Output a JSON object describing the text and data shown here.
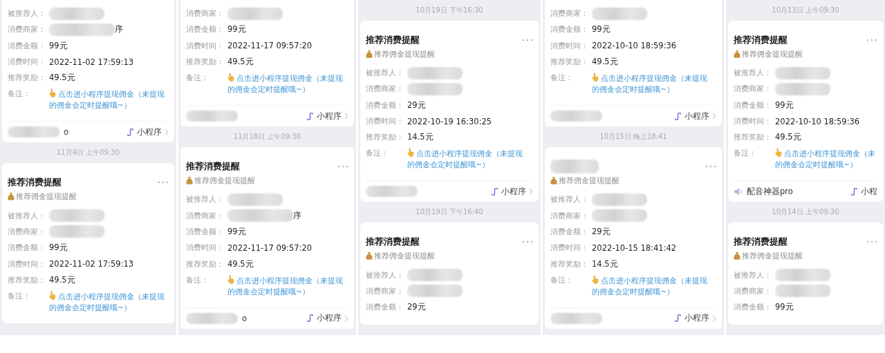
{
  "columns": [
    {
      "items": [
        {
          "kind": "card",
          "rows": [
            {
              "label": "被推荐人：",
              "redacted": true
            },
            {
              "label": "消费商家：",
              "redacted": true,
              "tail": "序"
            },
            {
              "label": "消费金额：",
              "value": "99元"
            },
            {
              "label": "消费时间：",
              "value": "2022-11-02 17:59:13"
            },
            {
              "label": "推荐奖励：",
              "value": "49.5元"
            }
          ],
          "remark": {
            "label": "备注：",
            "lines": [
              "点击进小程序提现佣金（未提现",
              "的佣金会定时提醒哦~）"
            ]
          },
          "footer": {
            "source_redacted": true,
            "source_tail": "o",
            "app": "小程序",
            "chevron": true
          }
        },
        {
          "kind": "time",
          "text": "11月4日 上午09:30"
        },
        {
          "kind": "card",
          "title": "推荐消费提醒",
          "subtitle": "推荐佣金提现提醒",
          "rows": [
            {
              "label": "被推荐人：",
              "redacted": true
            },
            {
              "label": "消费商家：",
              "redacted": true
            },
            {
              "label": "消费金额：",
              "value": "99元"
            },
            {
              "label": "消费时间：",
              "value": "2022-11-02 17:59:13"
            },
            {
              "label": "推荐奖励：",
              "value": "49.5元"
            }
          ],
          "remark": {
            "label": "备注：",
            "lines": [
              "点击进小程序提现佣金（未提现",
              "的佣金会定时提醒哦~）"
            ]
          }
        }
      ]
    },
    {
      "items": [
        {
          "kind": "card",
          "rows": [
            {
              "label": "消费商家：",
              "redacted": true
            },
            {
              "label": "消费金额：",
              "value": "99元"
            },
            {
              "label": "消费时间：",
              "value": "2022-11-17 09:57:20"
            },
            {
              "label": "推荐奖励：",
              "value": "49.5元"
            }
          ],
          "remark": {
            "label": "备注：",
            "lines": [
              "点击进小程序提现佣金（未提现",
              "的佣金会定时提醒哦~）"
            ]
          },
          "footer": {
            "source_redacted": true,
            "app": "小程序",
            "chevron": true
          }
        },
        {
          "kind": "time",
          "text": "11月18日 上午09:30"
        },
        {
          "kind": "card",
          "title": "推荐消费提醒",
          "subtitle": "推荐佣金提现提醒",
          "rows": [
            {
              "label": "被推荐人：",
              "redacted": true
            },
            {
              "label": "消费商家：",
              "redacted": true,
              "tail": "序"
            },
            {
              "label": "消费金额：",
              "value": "99元"
            },
            {
              "label": "消费时间：",
              "value": "2022-11-17 09:57:20"
            },
            {
              "label": "推荐奖励：",
              "value": "49.5元"
            }
          ],
          "remark": {
            "label": "备注：",
            "lines": [
              "点击进小程序提现佣金（未提现",
              "的佣金会定时提醒哦~）"
            ]
          },
          "footer": {
            "source_redacted": true,
            "source_tail": "o",
            "app": "小程序",
            "chevron": true
          }
        }
      ]
    },
    {
      "items": [
        {
          "kind": "time",
          "text": "10月19日 下午16:30"
        },
        {
          "kind": "card",
          "title": "推荐消费提醒",
          "subtitle": "推荐佣金提现提醒",
          "rows": [
            {
              "label": "被推荐人：",
              "redacted": true
            },
            {
              "label": "消费商家：",
              "redacted": true
            },
            {
              "label": "消费金额：",
              "value": "29元"
            },
            {
              "label": "消费时间：",
              "value": "2022-10-19 16:30:25"
            },
            {
              "label": "推荐奖励：",
              "value": "14.5元"
            }
          ],
          "remark": {
            "label": "备注：",
            "lines": [
              "点击进小程序提现佣金（未提现",
              "的佣金会定时提醒哦~）"
            ]
          },
          "footer": {
            "source_redacted": true,
            "app": "小程序",
            "chevron": true
          }
        },
        {
          "kind": "time",
          "text": "10月19日 下午16:40"
        },
        {
          "kind": "card",
          "title": "推荐消费提醒",
          "subtitle": "推荐佣金提现提醒",
          "rows": [
            {
              "label": "被推荐人：",
              "redacted": true
            },
            {
              "label": "消费商家：",
              "redacted": true
            },
            {
              "label": "消费金额：",
              "value": "29元"
            }
          ]
        }
      ]
    },
    {
      "items": [
        {
          "kind": "card",
          "rows": [
            {
              "label": "消费商家：",
              "redacted": true
            },
            {
              "label": "消费金额：",
              "value": "99元"
            },
            {
              "label": "消费时间：",
              "value": "2022-10-10 18:59:36"
            },
            {
              "label": "推荐奖励：",
              "value": "49.5元"
            }
          ],
          "remark": {
            "label": "备注：",
            "lines": [
              "点击进小程序提现佣金（未提现",
              "的佣金会定时提醒哦~）"
            ]
          },
          "footer": {
            "source_redacted": true,
            "app": "小程序",
            "chevron": true
          }
        },
        {
          "kind": "time",
          "text": "10月15日 晚上18:41"
        },
        {
          "kind": "card",
          "title_redacted": true,
          "subtitle": "推荐佣金提现提醒",
          "rows": [
            {
              "label": "被推荐人：",
              "redacted": true
            },
            {
              "label": "消费商家：",
              "redacted": true
            },
            {
              "label": "消费金额：",
              "value": "29元"
            },
            {
              "label": "消费时间：",
              "value": "2022-10-15 18:41:42"
            },
            {
              "label": "推荐奖励：",
              "value": "14.5元"
            }
          ],
          "remark": {
            "label": "备注：",
            "lines": [
              "点击进小程序提现佣金（未提现",
              "的佣金会定时提醒哦~）"
            ]
          },
          "footer": {
            "source_redacted": true,
            "app": "小程序",
            "chevron": true
          }
        }
      ]
    },
    {
      "items": [
        {
          "kind": "time",
          "text": "10月13日 上午09:30"
        },
        {
          "kind": "card",
          "title": "推荐消费提醒",
          "subtitle": "推荐佣金提现提醒",
          "rows": [
            {
              "label": "被推荐人：",
              "redacted": true
            },
            {
              "label": "消费商家：",
              "redacted": true
            },
            {
              "label": "消费金额：",
              "value": "99元"
            },
            {
              "label": "消费时间：",
              "value": "2022-10-10 18:59:36"
            },
            {
              "label": "推荐奖励：",
              "value": "49.5元"
            }
          ],
          "remark": {
            "label": "备注：",
            "lines": [
              "点击进小程序提现佣金（未",
              "的佣金会定时提醒哦~）"
            ]
          },
          "footer": {
            "source_redacted": false,
            "source": "配音神器pro",
            "app": "小程",
            "chevron": false
          }
        },
        {
          "kind": "time",
          "text": "10月14日 上午09:30"
        },
        {
          "kind": "card",
          "title": "推荐消费提醒",
          "subtitle": "推荐佣金提现提醒",
          "rows": [
            {
              "label": "被推荐人：",
              "redacted": true
            },
            {
              "label": "消费商家：",
              "redacted": true
            },
            {
              "label": "消费金额：",
              "value": "99元"
            }
          ]
        }
      ]
    }
  ]
}
